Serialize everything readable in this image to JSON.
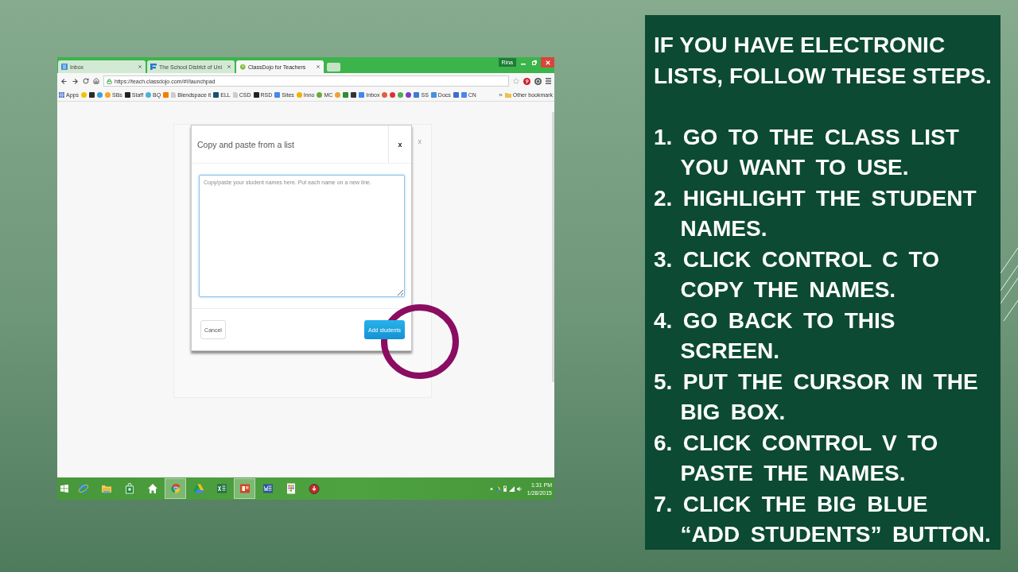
{
  "browser": {
    "tabs": [
      {
        "title": "Inbox",
        "kind": "mail",
        "selected": false
      },
      {
        "title": "The School District of Uni",
        "kind": "flag",
        "selected": false
      },
      {
        "title": "ClassDojo for Teachers",
        "kind": "blob",
        "selected": true
      }
    ],
    "profile_name": "Rina",
    "address": "https://teach.classdojo.com/#!/launchpad",
    "bookmarks": [
      {
        "label": "Apps",
        "kind": "grid",
        "color": "#4a7bd6"
      },
      {
        "kind": "dot",
        "color": "#f2c200"
      },
      {
        "kind": "tile",
        "color": "#2b2b2b"
      },
      {
        "kind": "dot",
        "color": "#3aa0d8"
      },
      {
        "label": "SBs",
        "kind": "dot",
        "color": "#f5a623"
      },
      {
        "label": "Staff",
        "kind": "tile",
        "color": "#222222"
      },
      {
        "label": "BQ",
        "kind": "dot",
        "color": "#4ab0e0"
      },
      {
        "kind": "tile",
        "color": "#f57d00"
      },
      {
        "label": "Blendspace it",
        "kind": "page",
        "color": "#cccccc"
      },
      {
        "label": "ELL",
        "kind": "tile",
        "color": "#1d4f6e"
      },
      {
        "label": "CSD",
        "kind": "page",
        "color": "#cccccc"
      },
      {
        "label": "RSD",
        "kind": "tile",
        "color": "#222222"
      },
      {
        "label": "Sites",
        "kind": "tile",
        "color": "#4a86e8"
      },
      {
        "label": "Inno",
        "kind": "dot",
        "color": "#f5b000"
      },
      {
        "label": "MC",
        "kind": "dot",
        "color": "#6aaa3a"
      },
      {
        "kind": "dot",
        "color": "#e8a33a"
      },
      {
        "kind": "tile",
        "color": "#2e8b3a"
      },
      {
        "kind": "tile",
        "color": "#333333"
      },
      {
        "label": "Inbox",
        "kind": "tile",
        "color": "#4285f4"
      },
      {
        "kind": "dot",
        "color": "#e06040"
      },
      {
        "kind": "dot",
        "color": "#e0303a"
      },
      {
        "kind": "dot",
        "color": "#4caf50"
      },
      {
        "kind": "dot",
        "color": "#7b3fc0"
      },
      {
        "label": "SS",
        "kind": "tile",
        "color": "#3a7bd5"
      },
      {
        "label": "Docs",
        "kind": "tile",
        "color": "#4a90d9"
      },
      {
        "kind": "tile",
        "color": "#3b6fd0"
      },
      {
        "label": "CN",
        "kind": "tile",
        "color": "#4a86e8"
      }
    ],
    "bookmarks_overflow": "»",
    "other_bookmarks": "Other bookmark"
  },
  "page": {
    "backdrop_close": "x"
  },
  "dialog": {
    "title": "Copy and paste from a list",
    "close": "x",
    "placeholder": "Copy/paste your student names here. Put each name on a new line.",
    "buttons": [
      {
        "label": "Cancel",
        "kind": "secondary"
      },
      {
        "label": "Add students",
        "kind": "primary"
      }
    ]
  },
  "taskbar": {
    "apps": [
      {
        "kind": "e",
        "selected": false
      },
      {
        "kind": "folder",
        "selected": false
      },
      {
        "kind": "bag",
        "selected": false
      },
      {
        "kind": "house",
        "selected": false
      },
      {
        "kind": "wheel",
        "selected": true
      },
      {
        "kind": "triangle",
        "selected": false
      },
      {
        "kind": "sheet",
        "selected": false
      },
      {
        "kind": "slides",
        "selected": true
      },
      {
        "kind": "doc",
        "selected": false
      },
      {
        "kind": "tiles",
        "selected": false
      },
      {
        "kind": "ball",
        "selected": false
      }
    ],
    "time": "1:31 PM",
    "date": "1/28/2015"
  },
  "instructions": {
    "heading": "IF YOU HAVE ELECTRONIC LISTS, FOLLOW THESE STEPS.",
    "steps": [
      "1. GO TO THE CLASS LIST YOU WANT TO USE.",
      "2. HIGHLIGHT THE STUDENT NAMES.",
      "3. CLICK CONTROL C TO COPY THE NAMES.",
      "4. GO BACK TO THIS SCREEN.",
      "5. PUT THE CURSOR IN THE BIG BOX.",
      "6. CLICK CONTROL V TO PASTE THE NAMES.",
      "7. CLICK THE BIG BLUE “ADD STUDENTS” BUTTON."
    ]
  }
}
